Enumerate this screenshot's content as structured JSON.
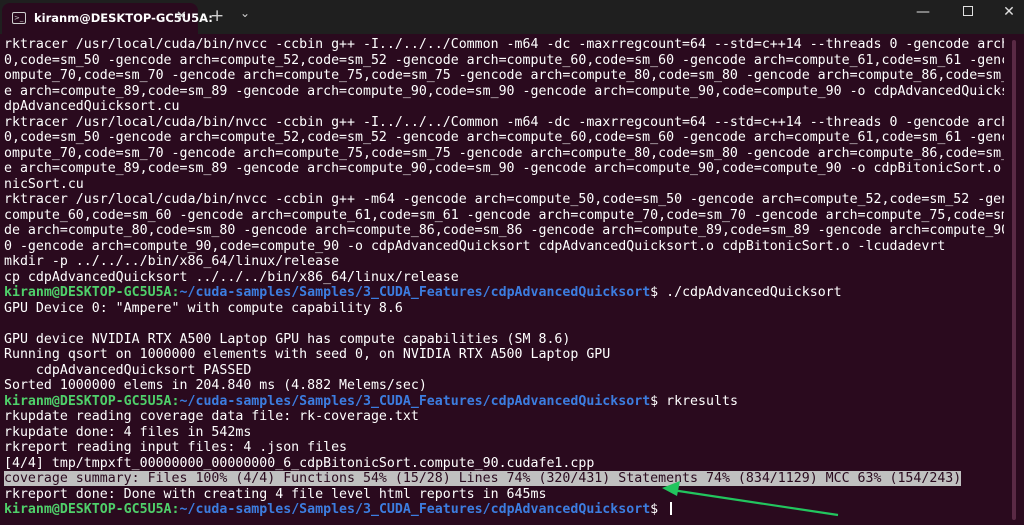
{
  "window": {
    "tab_title": "kiranm@DESKTOP-GC5U5A:",
    "tab_close": "✕",
    "new_tab": "+",
    "dropdown": "⌄",
    "minimize": "—",
    "close": "✕"
  },
  "terminal": {
    "lines": [
      {
        "text": "rktracer /usr/local/cuda/bin/nvcc -ccbin g++ -I../../../Common -m64 -dc -maxrregcount=64 --std=c++14 --threads 0 -gencode arch=compute_5"
      },
      {
        "text": "0,code=sm_50 -gencode arch=compute_52,code=sm_52 -gencode arch=compute_60,code=sm_60 -gencode arch=compute_61,code=sm_61 -gencode arch=c"
      },
      {
        "text": "ompute_70,code=sm_70 -gencode arch=compute_75,code=sm_75 -gencode arch=compute_80,code=sm_80 -gencode arch=compute_86,code=sm_86 -gencod"
      },
      {
        "text": "e arch=compute_89,code=sm_89 -gencode arch=compute_90,code=sm_90 -gencode arch=compute_90,code=compute_90 -o cdpAdvancedQuicksort.o -c c"
      },
      {
        "text": "dpAdvancedQuicksort.cu"
      },
      {
        "text": "rktracer /usr/local/cuda/bin/nvcc -ccbin g++ -I../../../Common -m64 -dc -maxrregcount=64 --std=c++14 --threads 0 -gencode arch=compute_5"
      },
      {
        "text": "0,code=sm_50 -gencode arch=compute_52,code=sm_52 -gencode arch=compute_60,code=sm_60 -gencode arch=compute_61,code=sm_61 -gencode arch=c"
      },
      {
        "text": "ompute_70,code=sm_70 -gencode arch=compute_75,code=sm_75 -gencode arch=compute_80,code=sm_80 -gencode arch=compute_86,code=sm_86 -gencod"
      },
      {
        "text": "e arch=compute_89,code=sm_89 -gencode arch=compute_90,code=sm_90 -gencode arch=compute_90,code=compute_90 -o cdpBitonicSort.o -c cdpBito"
      },
      {
        "text": "nicSort.cu"
      },
      {
        "text": "rktracer /usr/local/cuda/bin/nvcc -ccbin g++ -m64 -gencode arch=compute_50,code=sm_50 -gencode arch=compute_52,code=sm_52 -gencode arch="
      },
      {
        "text": "compute_60,code=sm_60 -gencode arch=compute_61,code=sm_61 -gencode arch=compute_70,code=sm_70 -gencode arch=compute_75,code=sm_75 -genco"
      },
      {
        "text": "de arch=compute_80,code=sm_80 -gencode arch=compute_86,code=sm_86 -gencode arch=compute_89,code=sm_89 -gencode arch=compute_90,code=sm_9"
      },
      {
        "text": "0 -gencode arch=compute_90,code=compute_90 -o cdpAdvancedQuicksort cdpAdvancedQuicksort.o cdpBitonicSort.o -lcudadevrt"
      },
      {
        "text": "mkdir -p ../../../bin/x86_64/linux/release"
      },
      {
        "text": "cp cdpAdvancedQuicksort ../../../bin/x86_64/linux/release"
      },
      {
        "user": "kiranm@DESKTOP-GC5U5A",
        "path": "~/cuda-samples/Samples/3_CUDA_Features/cdpAdvancedQuicksort",
        "cmd": "$ ./cdpAdvancedQuicksort"
      },
      {
        "text": "GPU Device 0: \"Ampere\" with compute capability 8.6"
      },
      {
        "text": ""
      },
      {
        "text": "GPU device NVIDIA RTX A500 Laptop GPU has compute capabilities (SM 8.6)"
      },
      {
        "text": "Running qsort on 1000000 elements with seed 0, on NVIDIA RTX A500 Laptop GPU"
      },
      {
        "text": "    cdpAdvancedQuicksort PASSED"
      },
      {
        "text": "Sorted 1000000 elems in 204.840 ms (4.882 Melems/sec)"
      },
      {
        "user": "kiranm@DESKTOP-GC5U5A",
        "path": "~/cuda-samples/Samples/3_CUDA_Features/cdpAdvancedQuicksort",
        "cmd": "$ rkresults"
      },
      {
        "text": "rkupdate reading coverage data file: rk-coverage.txt"
      },
      {
        "text": "rkupdate done: 4 files in 542ms"
      },
      {
        "text": "rkreport reading input files: 4 .json files"
      },
      {
        "text": "[4/4] tmp/tmpxft_00000000_00000000_6_cdpBitonicSort.compute_90.cudafe1.cpp"
      },
      {
        "text": "coverage summary: Files 100% (4/4) Functions 54% (15/28) Lines 74% (320/431) Statements 74% (834/1129) MCC 63% (154/243)",
        "highlight": true
      },
      {
        "text": "rkreport done: Done with creating 4 file level html reports in 645ms"
      },
      {
        "user": "kiranm@DESKTOP-GC5U5A",
        "path": "~/cuda-samples/Samples/3_CUDA_Features/cdpAdvancedQuicksort",
        "cmd": "$ ",
        "cursor": true
      }
    ]
  },
  "colors": {
    "background": "#2a0a1e",
    "prompt_user": "#4fd06a",
    "prompt_path": "#3c7de0",
    "annotation_arrow": "#22c55e"
  }
}
